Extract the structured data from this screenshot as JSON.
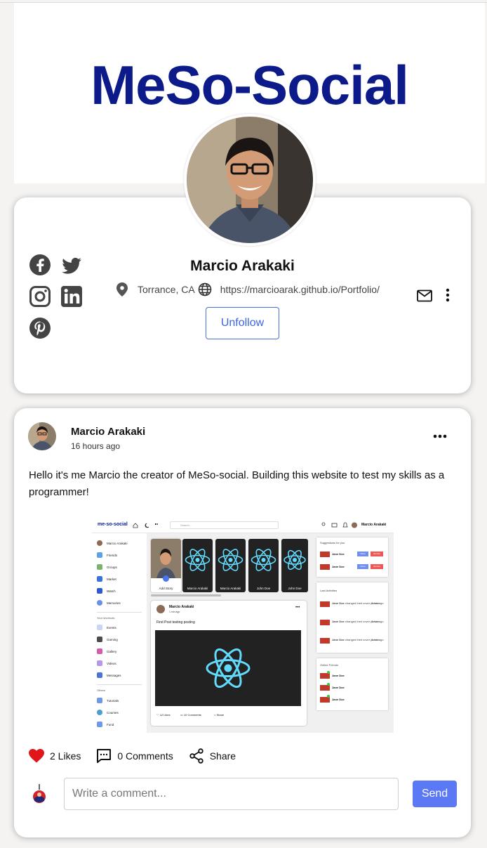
{
  "cover": {
    "logo_text": "MeSo-Social"
  },
  "profile": {
    "name": "Marcio Arakaki",
    "location": "Torrance, CA",
    "website": "https://marcioarak.github.io/Portfolio/",
    "follow_button_label": "Unfollow",
    "social_icons": [
      "facebook-icon",
      "twitter-icon",
      "instagram-icon",
      "linkedin-icon",
      "pinterest-icon"
    ]
  },
  "post": {
    "author": "Marcio Arakaki",
    "time": "16 hours ago",
    "text": "Hello it's me Marcio the creator of MeSo-social. Building this website to test my skills as a programmer!",
    "likes_label": "2 Likes",
    "comments_label": "0 Comments",
    "share_label": "Share",
    "comment_placeholder": "Write a comment...",
    "send_label": "Send"
  },
  "post_image": {
    "logo": "me-so-social",
    "search_placeholder": "Search...",
    "user": "Marcio Arakaki",
    "sidebar_items": [
      "Marcio Arakaki",
      "Friends",
      "Groups",
      "Market",
      "Watch",
      "Memories"
    ],
    "shortcuts_title": "Your shortcuts",
    "shortcut_items": [
      "Events",
      "Gaming",
      "Gallery",
      "Videos",
      "Messages"
    ],
    "others_title": "Others",
    "other_items": [
      "Tutorials",
      "Courses",
      "Fund"
    ],
    "stories": [
      "Add Story",
      "Marcio Arakaki",
      "Marcio Arakaki",
      "John Doe",
      "John Doe"
    ],
    "post_author": "Marcio Arakaki",
    "post_time": "1 min ago",
    "post_text": "First Post testing posting",
    "post_likes": "12 Likes",
    "post_comments": "10 Comments",
    "post_share": "Share",
    "suggestions_title": "Suggestions for you",
    "suggestion_names": [
      "Jane Doe",
      "Jane Doe"
    ],
    "suggestion_follow": "follow",
    "suggestion_dismiss": "dismiss",
    "activities_title": "Last Activities",
    "activity_name": "Jane Doe",
    "activity_text": "changed their cover picture",
    "activity_time": "1 min ago",
    "online_title": "Online Friends",
    "online_names": [
      "Jane Doe",
      "Jane Doe",
      "Jane Doe"
    ]
  },
  "colors": {
    "logo": "#0c1a8a",
    "accent": "#5b78f5",
    "like": "#e0161b"
  }
}
